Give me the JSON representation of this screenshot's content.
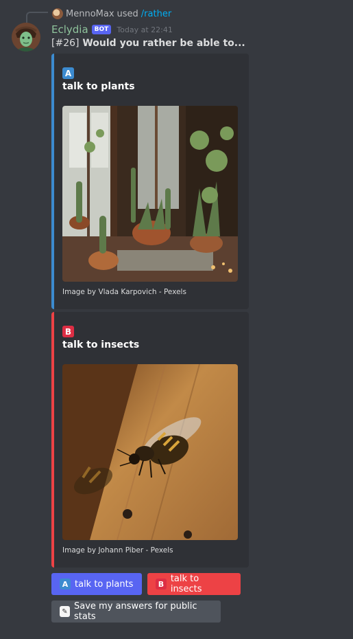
{
  "reply": {
    "user": "MennoMax",
    "action": "used",
    "command": "/rather"
  },
  "message": {
    "author": "Eclydia",
    "badge": "BOT",
    "timestamp": "Today at 22:41",
    "number": "[#26]",
    "question": "Would you rather be able to..."
  },
  "embeds": [
    {
      "letter": "A",
      "title": "talk to plants",
      "footer": "Image by Vlada Karpovich - Pexels",
      "accent": "#3c8bd0"
    },
    {
      "letter": "B",
      "title": "talk to insects",
      "footer": "Image by Johann Piber - Pexels",
      "accent": "#ed4245"
    }
  ],
  "buttons": {
    "option_a": {
      "icon": "A",
      "label": "talk to plants"
    },
    "option_b": {
      "icon": "B",
      "label": "talk to insects"
    },
    "save": {
      "icon": "memo-icon",
      "label": "Save my answers for public stats"
    }
  },
  "colors": {
    "background": "#36393f",
    "embed_bg": "#2f3136",
    "blurple": "#5865f2",
    "red": "#ed4245",
    "grey_button": "#4f545c",
    "username": "#8fc49c",
    "link": "#00aff4"
  }
}
